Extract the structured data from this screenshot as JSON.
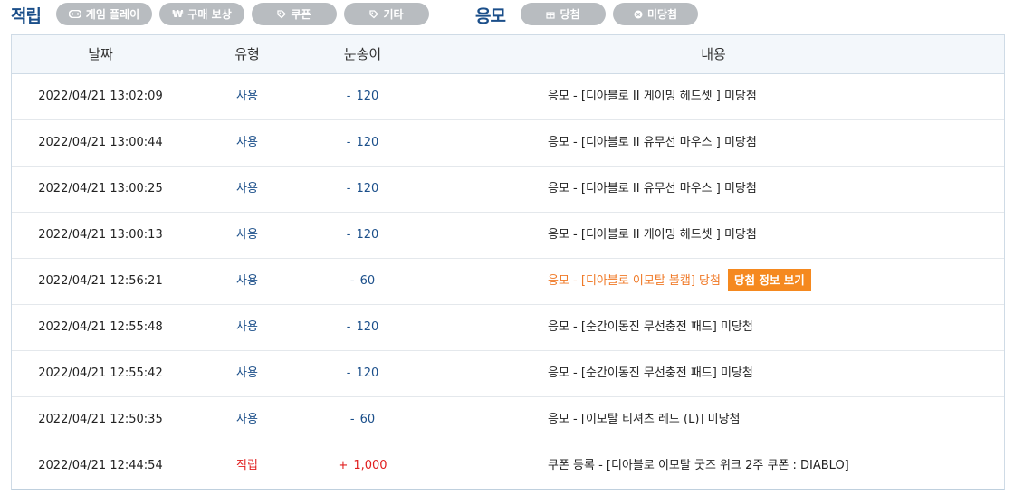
{
  "filters": {
    "earn": {
      "title": "적립",
      "pills": [
        {
          "label": "게임 플레이",
          "icon": "gamepad-icon"
        },
        {
          "label": "구매 보상",
          "icon": "won-icon"
        },
        {
          "label": "쿠폰",
          "icon": "tag-icon"
        },
        {
          "label": "기타",
          "icon": "tag-icon"
        }
      ]
    },
    "entry": {
      "title": "응모",
      "pills": [
        {
          "label": "당첨",
          "icon": "gift-icon"
        },
        {
          "label": "미당첨",
          "icon": "x-circle-icon"
        }
      ]
    }
  },
  "table": {
    "headers": {
      "date": "날짜",
      "type": "유형",
      "amount": "눈송이",
      "content": "내용"
    },
    "rows": [
      {
        "date": "2022/04/21 13:02:09",
        "type": "사용",
        "sign": "-",
        "amount": "120",
        "content": "응모 - [디아블로 II 게이밍 헤드셋 ] 미당첨",
        "win": false
      },
      {
        "date": "2022/04/21 13:00:44",
        "type": "사용",
        "sign": "-",
        "amount": "120",
        "content": "응모 - [디아블로 II 유무선 마우스 ] 미당첨",
        "win": false
      },
      {
        "date": "2022/04/21 13:00:25",
        "type": "사용",
        "sign": "-",
        "amount": "120",
        "content": "응모 - [디아블로 II 유무선 마우스 ] 미당첨",
        "win": false
      },
      {
        "date": "2022/04/21 13:00:13",
        "type": "사용",
        "sign": "-",
        "amount": "120",
        "content": "응모 - [디아블로 II 게이밍 헤드셋 ] 미당첨",
        "win": false
      },
      {
        "date": "2022/04/21 12:56:21",
        "type": "사용",
        "sign": "-",
        "amount": "60",
        "content": "응모 - [디아블로 이모탈 볼캡] 당첨",
        "win": true,
        "button": "당첨 정보 보기"
      },
      {
        "date": "2022/04/21 12:55:48",
        "type": "사용",
        "sign": "-",
        "amount": "120",
        "content": "응모 - [순간이동진 무선충전 패드] 미당첨",
        "win": false
      },
      {
        "date": "2022/04/21 12:55:42",
        "type": "사용",
        "sign": "-",
        "amount": "120",
        "content": "응모 - [순간이동진 무선충전 패드] 미당첨",
        "win": false
      },
      {
        "date": "2022/04/21 12:50:35",
        "type": "사용",
        "sign": "-",
        "amount": "60",
        "content": "응모 - [이모탈 티셔츠 레드 (L)] 미당첨",
        "win": false
      },
      {
        "date": "2022/04/21 12:44:54",
        "type": "적립",
        "sign": "+",
        "amount": "1,000",
        "content": "쿠폰 등록 - [디아블로 이모탈 굿즈 위크 2주 쿠폰 : DIABLO]",
        "win": false
      }
    ]
  },
  "colors": {
    "accent_blue": "#1b4f8a",
    "earn_red": "#e01e1e",
    "win_orange": "#f07a28",
    "win_button": "#f5891f",
    "pill_gray": "#b8bcc0"
  }
}
